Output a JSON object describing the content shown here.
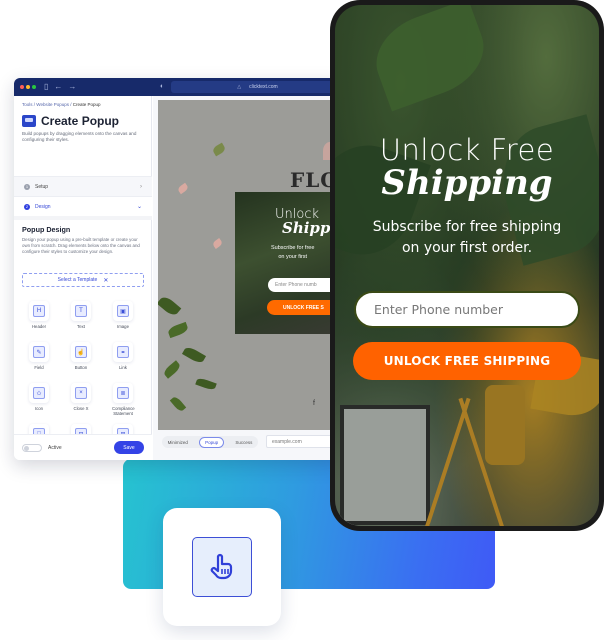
{
  "browser": {
    "url": "clicktext.com",
    "traffic_lights": [
      "#ff5f57",
      "#febc2e",
      "#28c840"
    ]
  },
  "sidebar": {
    "breadcrumb": [
      "Tools",
      "Website Popups",
      "Create Popup"
    ],
    "breadcrumb_sep": " / ",
    "title": "Create Popup",
    "subtitle": "Build popups by dragging elements onto the canvas and configuring their styles.",
    "steps": [
      {
        "num": "1",
        "label": "Setup",
        "state": "collapsed"
      },
      {
        "num": "2",
        "label": "Design",
        "state": "expanded"
      }
    ],
    "popup_design": {
      "title": "Popup Design",
      "description": "Design your popup using a pre-built template or create your own from scratch. Drag elements below onto the canvas and configure their styles to customize your design.",
      "template_button": "Select a Template"
    },
    "elements": [
      {
        "label": "Header",
        "icon": "H"
      },
      {
        "label": "Text",
        "icon": "T"
      },
      {
        "label": "Image",
        "icon": "▣"
      },
      {
        "label": "Field",
        "icon": "✎"
      },
      {
        "label": "Button",
        "icon": "☝"
      },
      {
        "label": "Link",
        "icon": "⚭"
      },
      {
        "label": "Icon",
        "icon": "✩"
      },
      {
        "label": "Close X",
        "icon": "×"
      },
      {
        "label": "Compliance Statement",
        "icon": "≣"
      },
      {
        "label": "",
        "icon": "□"
      },
      {
        "label": "",
        "icon": "⊟"
      },
      {
        "label": "",
        "icon": "⊞"
      }
    ],
    "footer": {
      "active_label": "Active",
      "active": false,
      "save_label": "Save"
    }
  },
  "canvas": {
    "brand_text": "FLO",
    "mini_popup": {
      "title_line1": "Unlock",
      "title_line2": "Shipp",
      "subtitle": "Subscribe for free\non your first",
      "input_placeholder": "Enter Phone numb",
      "button_label": "UNLOCK FREE S"
    },
    "view_tabs": [
      "Minimized",
      "Popup",
      "Success"
    ],
    "selected_tab": "Popup",
    "url_placeholder": "example.com"
  },
  "phone_popup": {
    "title_line1": "Unlock Free",
    "title_line2": "Shipping",
    "subtitle_line1": "Subscribe for free shipping",
    "subtitle_line2": "on your first order.",
    "input_placeholder": "Enter Phone number",
    "button_label": "UNLOCK FREE SHIPPING",
    "button_color": "#ff6200"
  },
  "colors": {
    "accent": "#3443e6",
    "titlebar": "#172a6a",
    "gradient_start": "#26c3d0",
    "gradient_end": "#3f5af6"
  }
}
